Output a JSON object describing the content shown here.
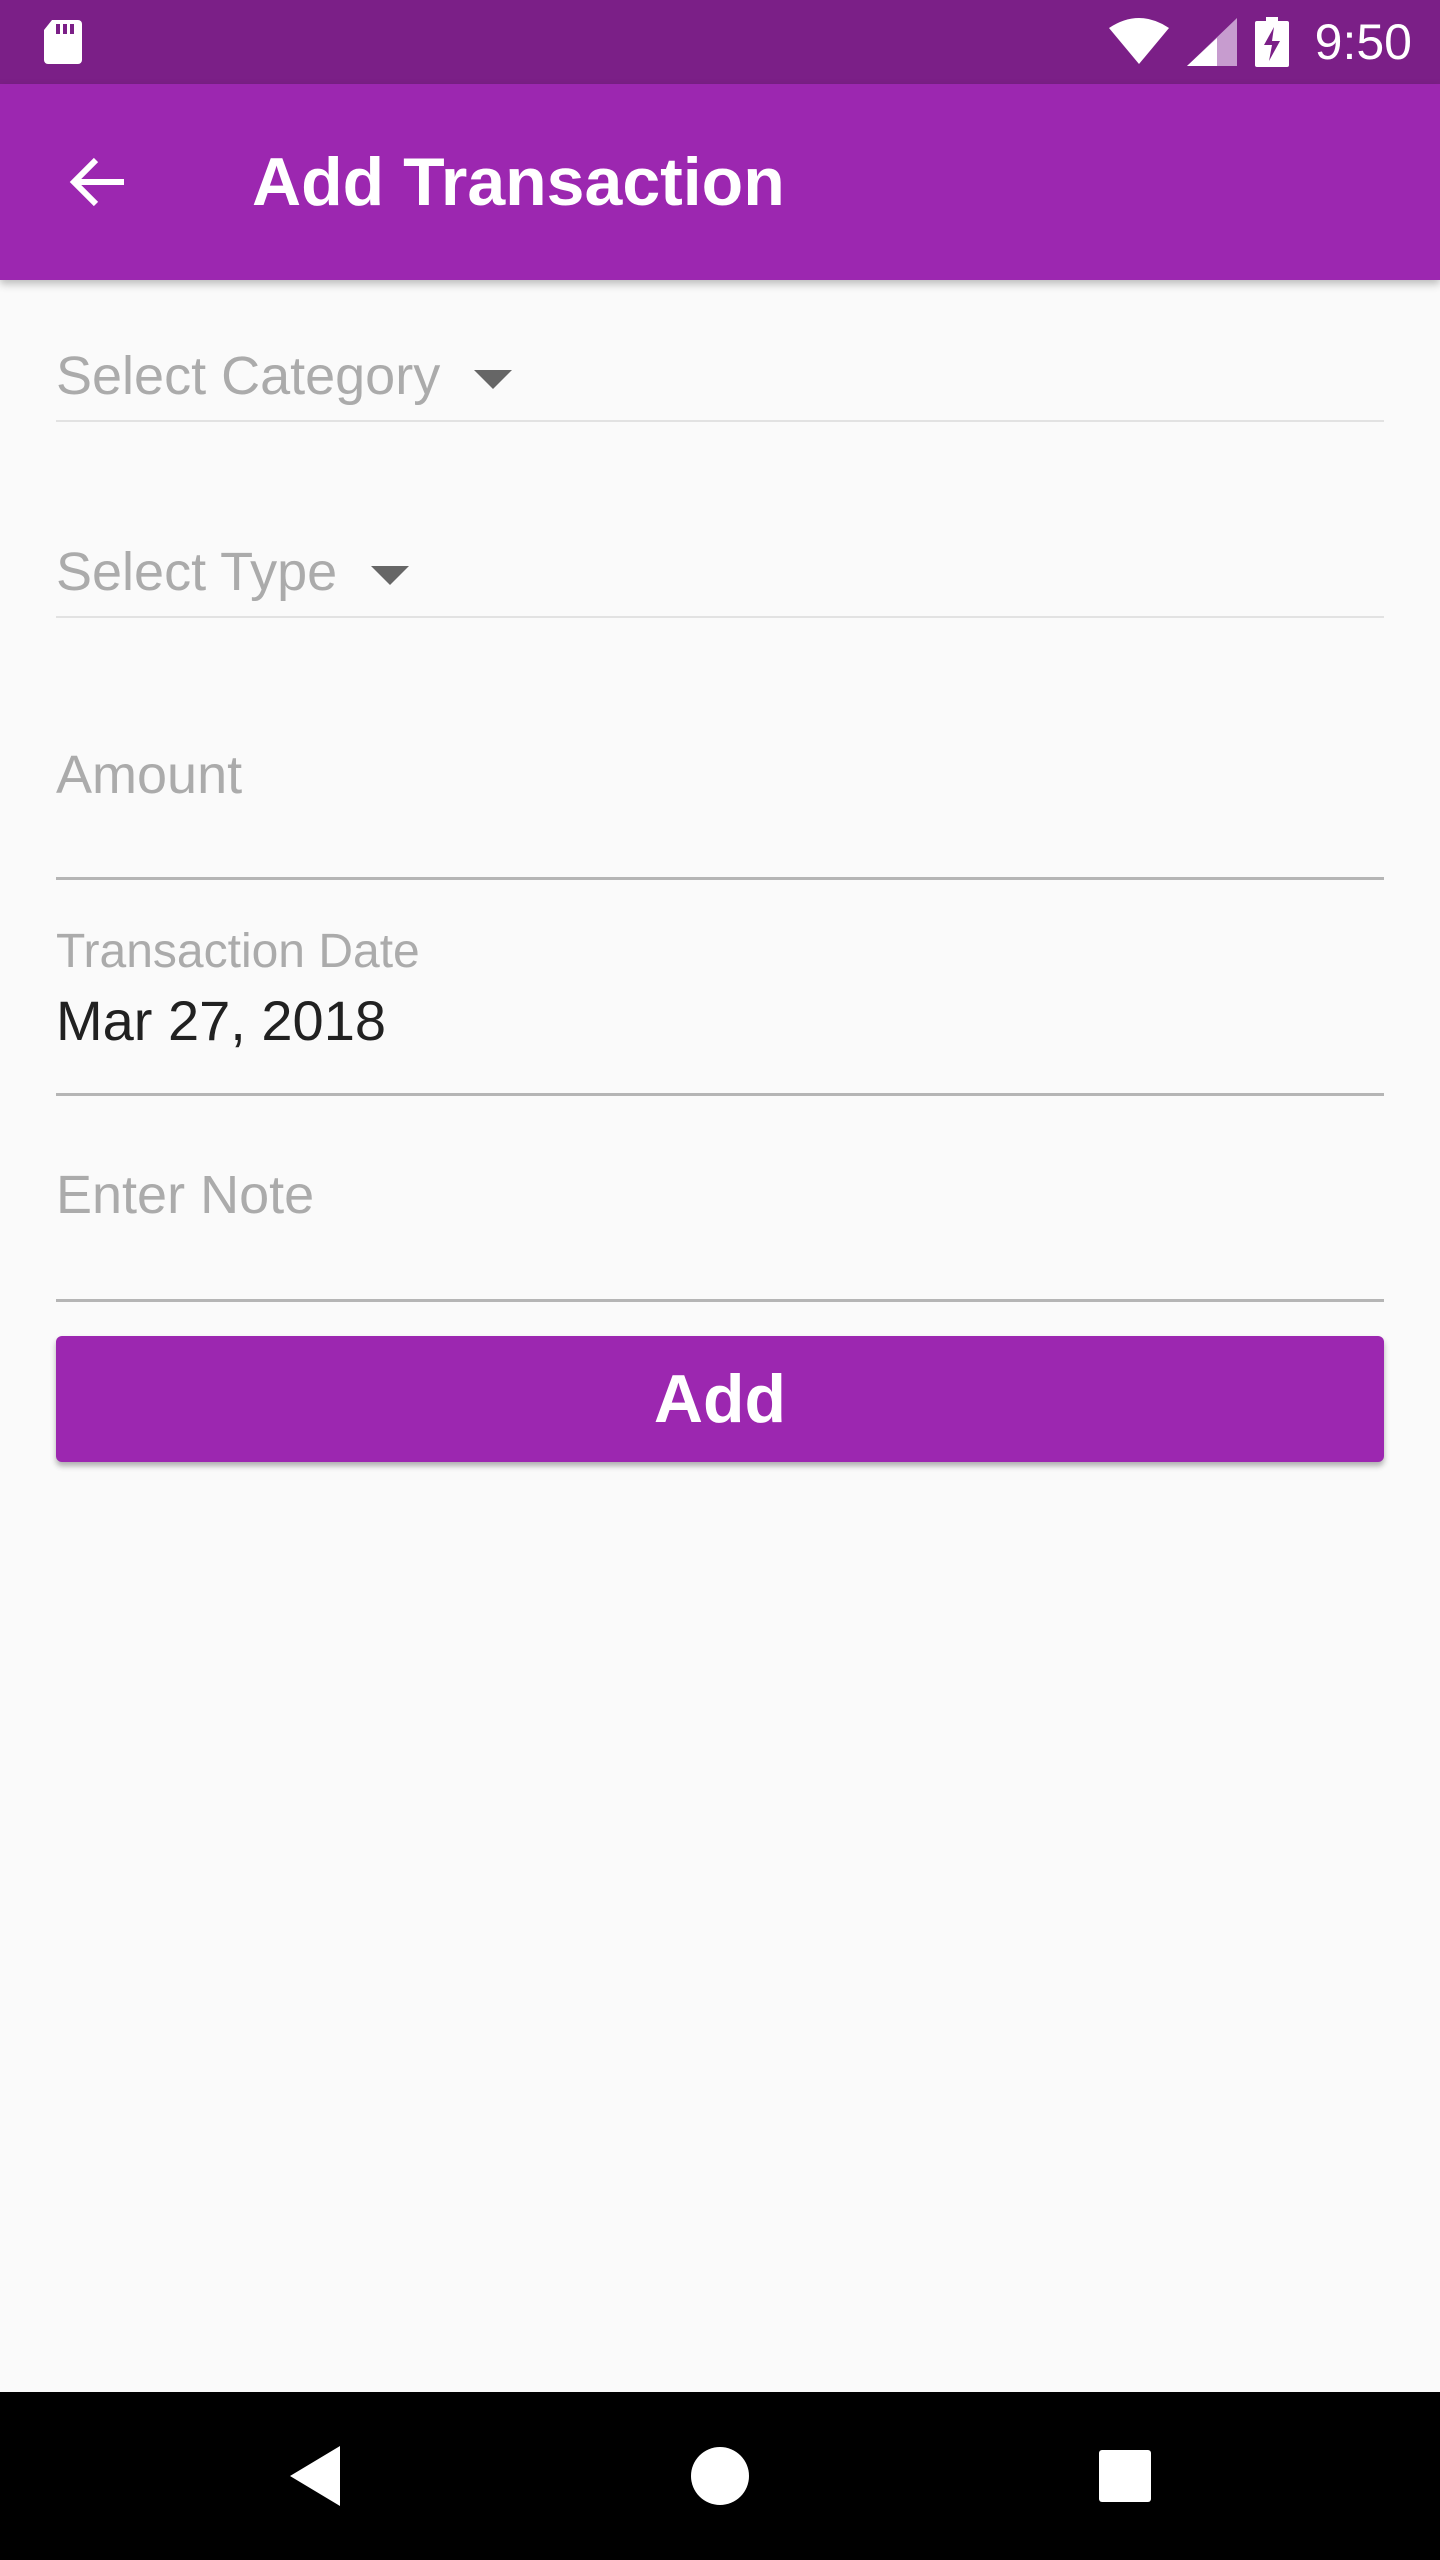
{
  "status_bar": {
    "time": "9:50",
    "icons": [
      "sd-card-icon",
      "wifi-icon",
      "signal-icon",
      "battery-charging-icon"
    ]
  },
  "app_bar": {
    "title": "Add Transaction",
    "back_icon": "arrow-left-icon"
  },
  "form": {
    "category": {
      "placeholder": "Select Category",
      "icon": "dropdown-caret-icon"
    },
    "type": {
      "placeholder": "Select Type",
      "icon": "dropdown-caret-icon"
    },
    "amount": {
      "placeholder": "Amount",
      "value": ""
    },
    "transaction_date": {
      "label": "Transaction Date",
      "value": "Mar 27, 2018"
    },
    "note": {
      "placeholder": "Enter Note",
      "value": ""
    },
    "add_button": "Add"
  },
  "nav_bar": {
    "icons": [
      "nav-back-icon",
      "nav-home-icon",
      "nav-recents-icon"
    ]
  },
  "colors": {
    "status_bar": "#7b1f87",
    "primary": "#9c27b0",
    "background": "#fafafa",
    "hint_text": "#ababab",
    "text": "#212121"
  }
}
